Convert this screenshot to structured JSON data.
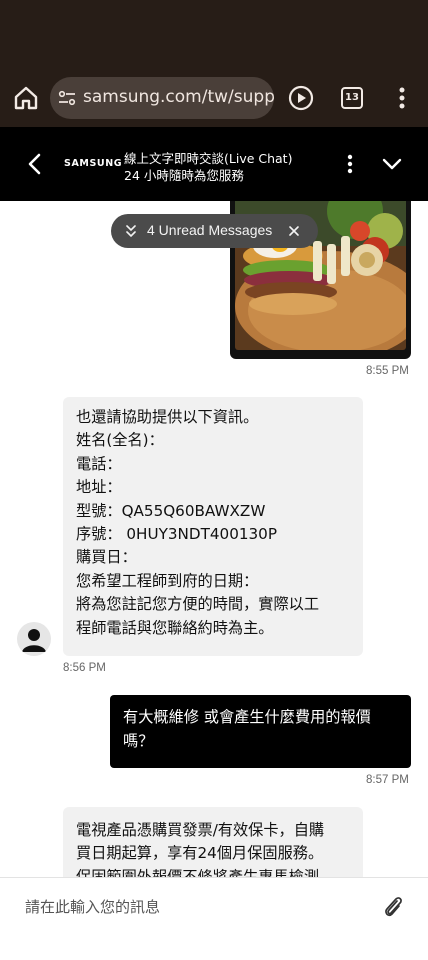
{
  "browser": {
    "url": "samsung.com/tw/suppor",
    "tab_count": "13"
  },
  "chat_header": {
    "brand": "SAMSUNG",
    "title": "線上文字即時交談(Live Chat)",
    "subtitle": "24 小時隨時為您服務"
  },
  "unread": {
    "label": "4 Unread Messages"
  },
  "messages": {
    "image_time": "8:55 PM",
    "agent_info": {
      "lines": [
        "也還請協助提供以下資訊。",
        "姓名(全名)：",
        "電話：",
        "地址：",
        "型號：QA55Q60BAWXZW",
        "序號： 0HUY3NDT400130P",
        "購買日：",
        "您希望工程師到府的日期：",
        "將為您註記您方便的時間，實際以工",
        "程師電話與您聯絡約時為主。"
      ],
      "time": "8:56 PM"
    },
    "user_question": {
      "text": "有大概維修 或會產生什麼費用的報價嗎？",
      "time": "8:57 PM"
    },
    "agent_warranty": {
      "lines": [
        "電視產品憑購買發票/有效保卡，自購",
        "買日期起算，享有24個月保固服務。",
        "保固範圍外報價不條將產生專馬檢測"
      ]
    }
  },
  "input": {
    "placeholder": "請在此輸入您的訊息"
  },
  "icons": {
    "home": "home-icon",
    "tune": "site-settings-icon",
    "play": "play-icon",
    "tabs": "tabs-icon",
    "menu": "more-vert-icon",
    "back": "back-icon",
    "kebab": "more-vert-icon",
    "collapse": "chevron-down-icon",
    "unread": "double-chevron-down-icon",
    "close": "close-icon",
    "avatar": "person-icon",
    "attach": "paperclip-icon"
  }
}
